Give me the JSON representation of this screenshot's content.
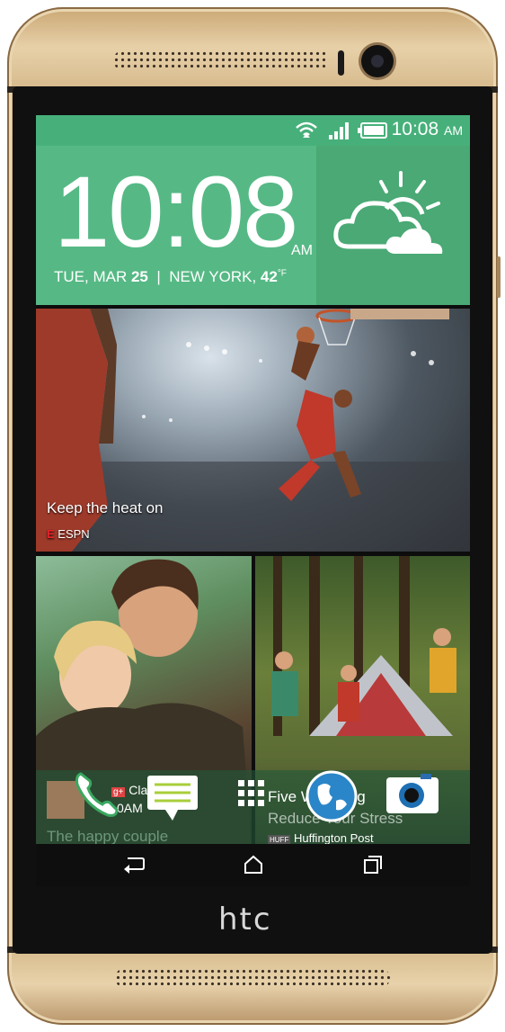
{
  "device": {
    "brand": "htc"
  },
  "status_bar": {
    "time": "10:08",
    "ampm": "AM"
  },
  "clock_widget": {
    "time": "10:08",
    "ampm": "AM",
    "day_date_prefix": "TUE, MAR ",
    "day_number": "25",
    "city": "NEW YORK, ",
    "temperature": "42",
    "unit": "°F",
    "weather_icon": "partly-cloudy-icon"
  },
  "feed": {
    "featured": {
      "caption": "Keep the heat on",
      "source": "ESPN"
    },
    "tile_left": {
      "contact": "Claire",
      "time": "0AM",
      "caption": "The happy couple"
    },
    "tile_right": {
      "headline_line1": "Five W",
      "headline_line1_end": "ing",
      "headline_line2": "Reduce Your Stress",
      "source": "Huffington Post"
    }
  },
  "dock": {
    "items": [
      {
        "icon": "phone-icon"
      },
      {
        "icon": "messages-icon"
      },
      {
        "icon": "app-drawer-icon"
      },
      {
        "icon": "browser-icon"
      },
      {
        "icon": "camera-icon"
      }
    ]
  },
  "navigation": {
    "back": "back-icon",
    "home": "home-icon",
    "recents": "recents-icon"
  },
  "colors": {
    "widget_green": "#56b985",
    "statusbar_green": "#47b07a",
    "body_gold": "#cfb17f"
  }
}
